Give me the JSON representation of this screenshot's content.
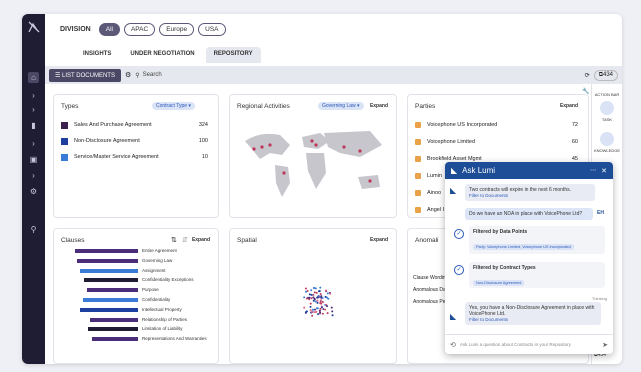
{
  "division": {
    "label": "DIVISION",
    "options": [
      "All",
      "APAC",
      "Europe",
      "USA"
    ],
    "selected": "All"
  },
  "tabs": [
    "INSIGHTS",
    "UNDER NEGOTIATION",
    "REPOSITORY"
  ],
  "toolbar": {
    "list_label": "LIST DOCUMENTS",
    "search_label": "Search",
    "count": "434"
  },
  "types": {
    "title": "Types",
    "filter": "Contract Type",
    "rows": [
      {
        "label": "Sales And Purchase Agreement",
        "value": "324",
        "color": "#3a1f4f"
      },
      {
        "label": "Non-Disclosure Agreement",
        "value": "100",
        "color": "#1d3fa0"
      },
      {
        "label": "Service/Master Service Agreement",
        "value": "10",
        "color": "#3a7bd5"
      }
    ]
  },
  "regional": {
    "title": "Regional Activities",
    "filter": "Governing Law",
    "expand": "Expand"
  },
  "parties": {
    "title": "Parties",
    "expand": "Expand",
    "rows": [
      {
        "label": "Voicephone US Incorporated",
        "value": "72"
      },
      {
        "label": "Voicephone Limited",
        "value": "60"
      },
      {
        "label": "Brookfield Asset Mgmt",
        "value": "45"
      },
      {
        "label": "Lumin",
        "value": ""
      },
      {
        "label": "Ainoo",
        "value": ""
      },
      {
        "label": "Angel I",
        "value": ""
      }
    ]
  },
  "clauses": {
    "title": "Clauses",
    "expand": "Expand",
    "rows": [
      {
        "label": "Entire Agreement",
        "value": 0.95,
        "color": "#4a2e7a"
      },
      {
        "label": "Governing Law",
        "value": 0.92,
        "color": "#4a2e7a"
      },
      {
        "label": "Assignment",
        "value": 0.88,
        "color": "#3a7bd5"
      },
      {
        "label": "Confidentiality Exceptions",
        "value": 0.82,
        "color": "#1f1d33"
      },
      {
        "label": "Purpose",
        "value": 0.78,
        "color": "#4a2e7a"
      },
      {
        "label": "Confidentiality",
        "value": 0.84,
        "color": "#3a7bd5"
      },
      {
        "label": "Intellectual Property",
        "value": 0.88,
        "color": "#1d3fa0"
      },
      {
        "label": "Relationship of Parties",
        "value": 0.72,
        "color": "#4a2e7a"
      },
      {
        "label": "Limitation of Liability",
        "value": 0.76,
        "color": "#1f1d33"
      },
      {
        "label": "Representations And Warranties",
        "value": 0.7,
        "color": "#4a2e7a"
      }
    ]
  },
  "spatial": {
    "title": "Spatial",
    "expand": "Expand"
  },
  "anomalies": {
    "title": "Anomali",
    "rows": [
      "Clause Wordin",
      "Anomalous Da",
      "Anomalous Pe"
    ]
  },
  "right_panel": {
    "header": "ACTION BAR",
    "items": [
      "TASK",
      "KNOWLEDGE"
    ],
    "count": "434"
  },
  "lumi": {
    "title": "Ask Lumi",
    "msg1": "Two contracts will expire in the next 6 months.",
    "msg1_link": "Filter to Documents",
    "user": "Do we have an NDA in place with VoicePhone Ltd?",
    "user_initials": "EH",
    "f1_title": "Filtered by Data Points",
    "f1_chip": "Party: Voicephone Limited, Voicephone US Incorporated",
    "f2_title": "Filtered by Contract Types",
    "f2_chip": "Non-Disclosure Agreement",
    "thinking": "Thinking",
    "answer": "Yes, you have a Non-Disclosure Agreement in place with VoicePhone Ltd.",
    "answer_link": "Filter to Documents",
    "placeholder": "Ask Lumi a question about Contracts in your Repository"
  }
}
